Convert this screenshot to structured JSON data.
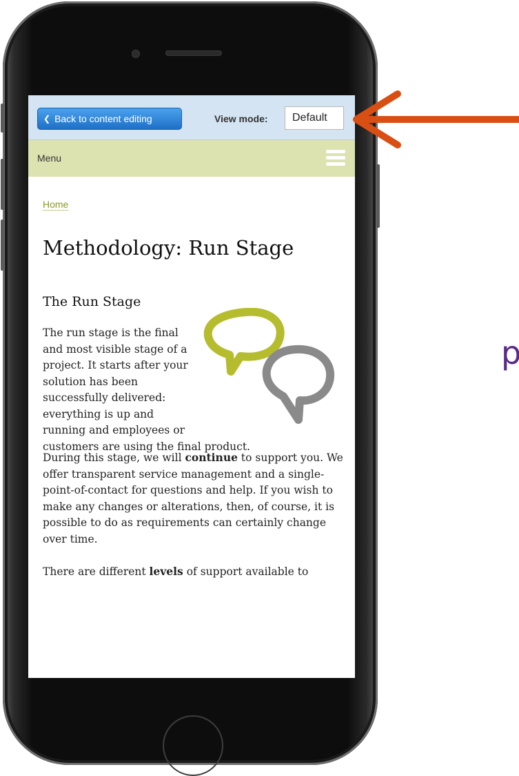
{
  "toolbar": {
    "back_label": "Back to content editing",
    "view_mode_label": "View mode:",
    "view_mode_value": "Default"
  },
  "menubar": {
    "label": "Menu"
  },
  "breadcrumb": {
    "home": "Home"
  },
  "page": {
    "title": "Methodology: Run Stage",
    "section_title": "The Run Stage",
    "para1": "The run stage is the final and most visible stage of a project. It starts after your solution has been successfully delivered: everything is up and running and employees or customers are using the final product.",
    "para2_before": "During this stage, we will ",
    "para2_bold": "continue",
    "para2_after": " to support you. We offer transparent service management and a single-point-of-contact for questions and help. If you wish to make any changes or alterations, then, of course, it is possible to do as requirements can certainly change over time.",
    "para3_before": "There are different ",
    "para3_bold": "levels",
    "para3_after": " of support available to"
  },
  "side_text": "p",
  "colors": {
    "toolbar_bg": "#d4e4f3",
    "menubar_bg": "#dde2b1",
    "link_color": "#8b9a1d",
    "arrow_color": "#d94e12",
    "bubble_green": "#b5bd2e",
    "bubble_gray": "#8a8a8a",
    "back_button": "#2a7fd6"
  },
  "icons": {
    "back": "chevron-left-icon",
    "menu": "hamburger-icon",
    "bubbles": "speech-bubbles-icon",
    "annotation": "arrow-left-icon"
  }
}
